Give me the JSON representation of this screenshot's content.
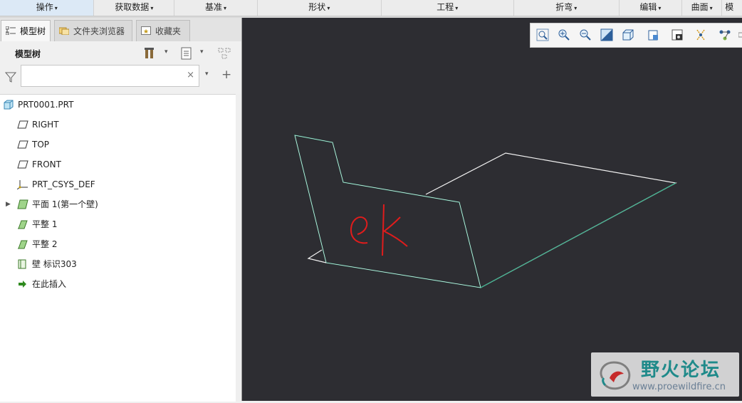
{
  "ribbon": {
    "tabs": [
      "操作",
      "获取数据",
      "基准",
      "形状",
      "工程",
      "折弯",
      "编辑",
      "曲面",
      "模"
    ]
  },
  "panel": {
    "tabs": [
      "模型树",
      "文件夹浏览器",
      "收藏夹"
    ],
    "title": "模型树",
    "search": {
      "value": "",
      "placeholder": "",
      "clear_glyph": "×"
    }
  },
  "tree": {
    "items": [
      {
        "label": "PRT0001.PRT",
        "icon": "part-icon"
      },
      {
        "label": "RIGHT",
        "icon": "datum-plane-icon"
      },
      {
        "label": "TOP",
        "icon": "datum-plane-icon"
      },
      {
        "label": "FRONT",
        "icon": "datum-plane-icon"
      },
      {
        "label": "PRT_CSYS_DEF",
        "icon": "csys-icon"
      },
      {
        "label": "平面 1(第一个壁)",
        "icon": "planar-wall-icon",
        "expandable": true
      },
      {
        "label": "平整 1",
        "icon": "flat-wall-icon"
      },
      {
        "label": "平整 2",
        "icon": "flat-wall-icon"
      },
      {
        "label": "壁 标识303",
        "icon": "wall-icon"
      },
      {
        "label": "在此插入",
        "icon": "insert-here-arrow-icon"
      }
    ]
  },
  "viewport": {
    "annotation": "ek",
    "annotation_color": "#e01c1c",
    "edge_color_selected": "#2fb58c",
    "edge_color": "#f2f2f2",
    "background": "#2d2d32"
  },
  "view_toolbar": {
    "icons": [
      "refit-icon",
      "zoom-in-icon",
      "zoom-out-icon",
      "repaint-icon",
      "display-style-icon",
      "saved-orientations-icon",
      "view-manager-icon",
      "datum-display-icon",
      "annotation-display-icon",
      "more-icon"
    ]
  },
  "watermark": {
    "title": "野火论坛",
    "url": "www.proewildfire.cn"
  }
}
